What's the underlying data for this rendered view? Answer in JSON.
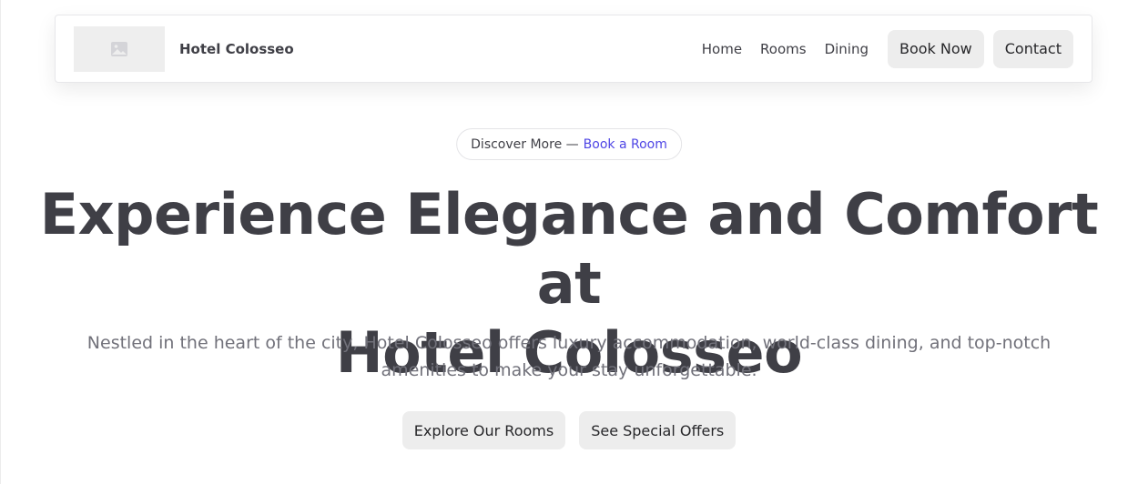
{
  "header": {
    "logo_icon": "image-placeholder-icon",
    "brand": "Hotel Colosseo",
    "nav_links": [
      "Home",
      "Rooms",
      "Dining"
    ],
    "book_now": "Book Now",
    "contact": "Contact"
  },
  "hero": {
    "badge": {
      "text": "Discover More —",
      "link": "Book a Room",
      "link_color": "#4f46e5"
    },
    "title_line1": "Experience Elegance and Comfort at",
    "title_line2": "Hotel Colosseo",
    "description": "Nestled in the heart of the city, Hotel Colosseo offers luxury accommodation, world-class dining, and top-notch amenities to make your stay unforgettable.",
    "primary_cta": "Explore Our Rooms",
    "secondary_cta": "See Special Offers"
  }
}
